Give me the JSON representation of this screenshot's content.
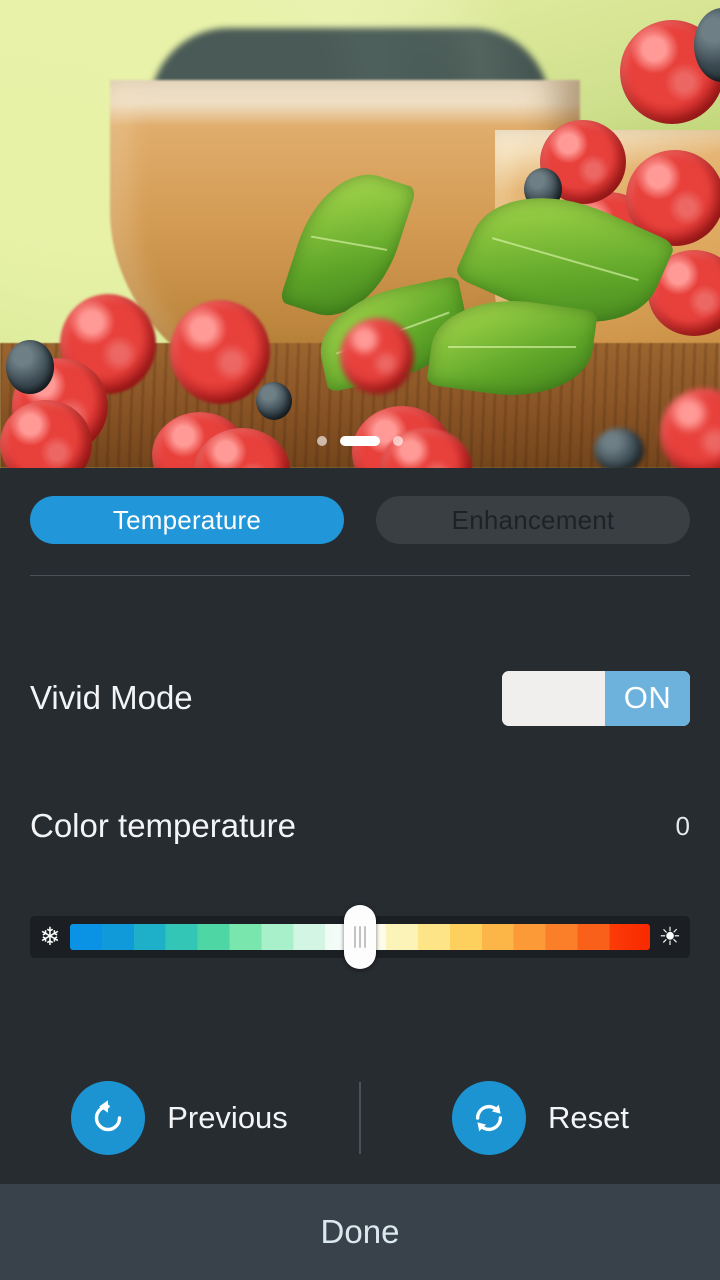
{
  "preview": {
    "name": "image-preview",
    "alt": "Photo of raspberries and blueberries in wooden bowls on a wooden table with green mint leaves",
    "pager": {
      "total": 3,
      "active_index": 1,
      "dots": [
        "page-dot-1",
        "page-dot-2-active",
        "page-dot-3"
      ]
    }
  },
  "tabs": [
    {
      "id": "temperature",
      "label": "Temperature",
      "active": true,
      "bg": "#2196d8",
      "fg": "#ffffff"
    },
    {
      "id": "enhancement",
      "label": "Enhancement",
      "active": false,
      "bg": "#3a3f44",
      "fg": "#1e2226"
    }
  ],
  "settings": {
    "vivid_mode": {
      "label": "Vivid Mode",
      "state_label": "ON",
      "enabled": true,
      "track_on_color": "#6cb2dd",
      "knob_color": "#f0efed"
    },
    "color_temperature": {
      "label": "Color temperature",
      "value": "0",
      "min": -100,
      "max": 100,
      "current": 0,
      "thumb_percent": 50,
      "cold_icon": "snowflake-icon",
      "cold_glyph": "❄",
      "warm_icon": "sun-icon",
      "warm_glyph": "☀",
      "gradient_cold_start": "#0a93e4",
      "gradient_mid": "#ffffff",
      "gradient_warm_end": "#fa2800"
    }
  },
  "actions": [
    {
      "id": "previous",
      "label": "Previous",
      "icon": "undo-arrow-icon",
      "circle_color": "#1c94d2"
    },
    {
      "id": "reset",
      "label": "Reset",
      "icon": "refresh-cycle-icon",
      "circle_color": "#1c94d2"
    }
  ],
  "bottom_bar": {
    "done_label": "Done",
    "bg": "#39424a",
    "fg": "#dbe9ef"
  },
  "theme": {
    "panel_bg": "#272c31",
    "divider": "#4a5157",
    "accent": "#2196d8",
    "text_primary": "#f2f4f5"
  }
}
